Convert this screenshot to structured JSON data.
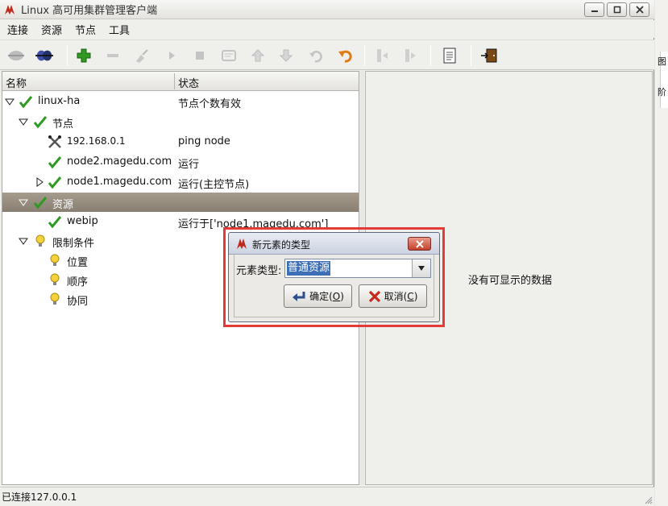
{
  "window": {
    "title": "Linux 高可用集群管理客户端"
  },
  "menu": [
    {
      "label": "连接"
    },
    {
      "label": "资源"
    },
    {
      "label": "节点"
    },
    {
      "label": "工具"
    }
  ],
  "toolbar": {
    "buttons": [
      "connect",
      "disconnect",
      "add-resource",
      "remove",
      "cleanup",
      "start",
      "stop",
      "edit",
      "move-up",
      "move-down",
      "undo",
      "redo",
      "standby",
      "active",
      "log",
      "exit"
    ]
  },
  "columns": {
    "name": "名称",
    "status": "状态"
  },
  "tree": [
    {
      "name": "linux-ha",
      "status": "节点个数有效",
      "icon": "check-icon",
      "expanded": true
    },
    {
      "name": "节点",
      "status": "",
      "icon": "check-icon",
      "expanded": true
    },
    {
      "name": "192.168.0.1",
      "status": "ping node",
      "icon": "tools-icon"
    },
    {
      "name": "node2.magedu.com",
      "status": "运行",
      "icon": "check-icon"
    },
    {
      "name": "node1.magedu.com",
      "status": "运行(主控节点)",
      "icon": "check-icon",
      "expanded": false
    },
    {
      "name": "资源",
      "status": "",
      "icon": "check-icon",
      "expanded": true,
      "selected": true
    },
    {
      "name": "webip",
      "status": "运行于['node1.magedu.com']",
      "icon": "check-icon"
    },
    {
      "name": "限制条件",
      "status": "",
      "icon": "bulb-icon",
      "expanded": true
    },
    {
      "name": "位置",
      "status": "",
      "icon": "bulb-icon"
    },
    {
      "name": "顺序",
      "status": "",
      "icon": "bulb-icon"
    },
    {
      "name": "协同",
      "status": "",
      "icon": "bulb-icon"
    }
  ],
  "detail": {
    "empty_text": "没有可显示的数据"
  },
  "status": {
    "text": "已连接127.0.0.1"
  },
  "dialog": {
    "title": "新元素的类型",
    "label": "元素类型:",
    "selected_value": "普通资源",
    "ok_text": "确定(",
    "ok_mnemonic": "O",
    "ok_close": ")",
    "cancel_text": "取消(",
    "cancel_mnemonic": "C",
    "cancel_close": ")"
  },
  "edge": {
    "t1": "图",
    "t2": "阶"
  },
  "colors": {
    "highlight": "#e33b37",
    "selection": "#8f8578",
    "accent_check": "#2f9a22"
  }
}
